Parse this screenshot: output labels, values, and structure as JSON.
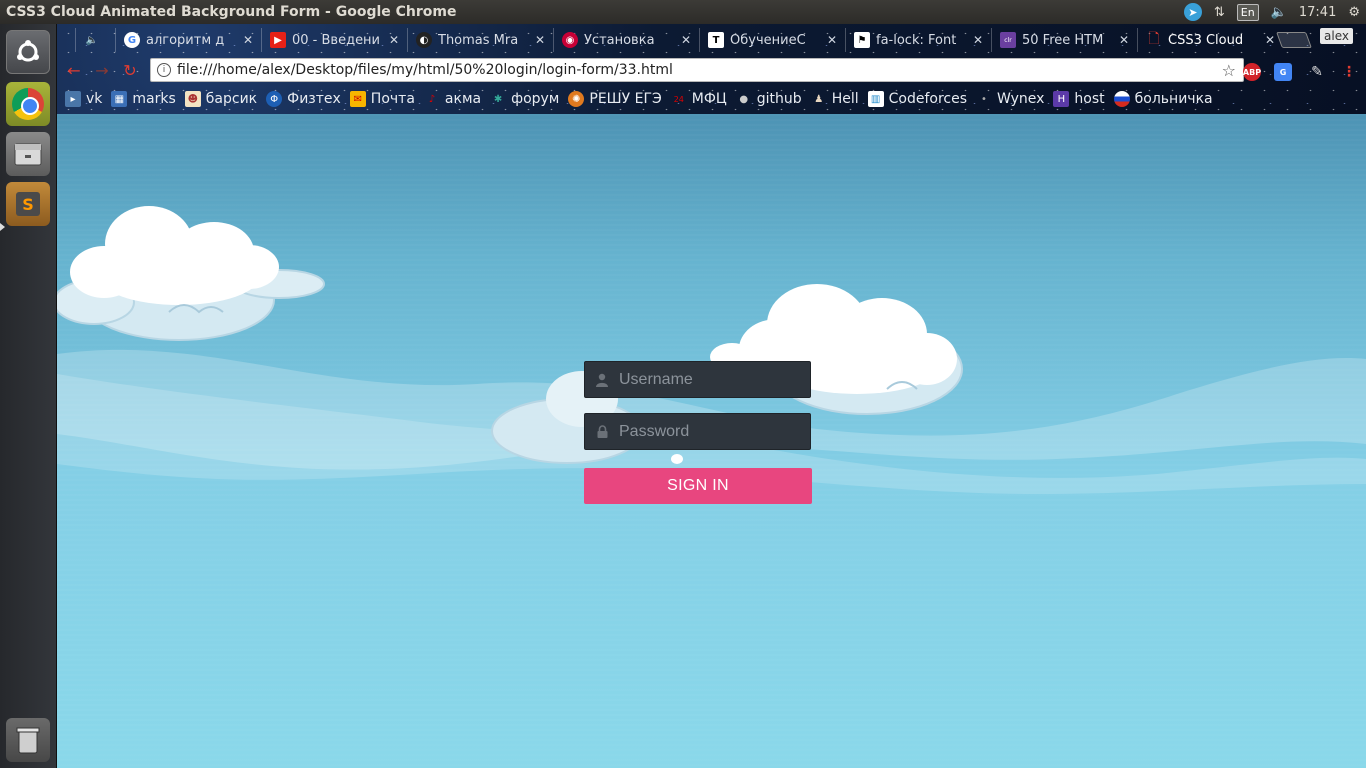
{
  "top_panel": {
    "window_title": "CSS3 Cloud Animated Background Form - Google Chrome",
    "keyboard_layout": "En",
    "clock": "17:41",
    "icons": [
      "telegram-icon",
      "network-icon",
      "volume-icon",
      "settings-gear-icon"
    ]
  },
  "launcher": {
    "items": [
      "dash-icon",
      "chrome-icon",
      "files-icon",
      "sublime-text-icon",
      "trash-icon"
    ]
  },
  "browser": {
    "profile_name": "alex",
    "tabs": [
      {
        "title": "алгоритм д",
        "icon": "google-icon",
        "active": false
      },
      {
        "title": "00 - Введени",
        "icon": "youtube-icon",
        "active": false
      },
      {
        "title": "Thomas Mra",
        "icon": "github-octocat-icon",
        "active": false
      },
      {
        "title": "Установка",
        "icon": "debian-icon",
        "active": false
      },
      {
        "title": "ОбучениеС",
        "icon": "t-letter-icon",
        "active": false
      },
      {
        "title": "fa-lock: Font",
        "icon": "flag-icon",
        "active": false
      },
      {
        "title": "50 Free HTM",
        "icon": "colorlib-icon",
        "active": false
      },
      {
        "title": "CSS3 Cloud",
        "icon": "document-icon",
        "active": true
      }
    ],
    "url": "file:///home/alex/Desktop/files/my/html/50%20login/login-form/33.html",
    "bookmarks": [
      {
        "label": "vk",
        "icon": "vk-icon"
      },
      {
        "label": "marks",
        "icon": "grid-icon"
      },
      {
        "label": "барсик",
        "icon": "cat-icon"
      },
      {
        "label": "Физтех",
        "icon": "phystech-icon"
      },
      {
        "label": "Почта",
        "icon": "mail-icon"
      },
      {
        "label": "акма",
        "icon": "akma-icon"
      },
      {
        "label": "форум",
        "icon": "forum-icon"
      },
      {
        "label": "РЕШУ ЕГЭ",
        "icon": "reshu-ege-icon"
      },
      {
        "label": "МФЦ",
        "icon": "mfc-icon"
      },
      {
        "label": "github",
        "icon": "github-icon"
      },
      {
        "label": "Hell",
        "icon": "person-icon"
      },
      {
        "label": "Codeforces",
        "icon": "codeforces-icon"
      },
      {
        "label": "Wynex",
        "icon": "wynex-icon"
      },
      {
        "label": "host",
        "icon": "host-icon"
      },
      {
        "label": "больничка",
        "icon": "russia-flag-icon"
      }
    ],
    "extensions": [
      "adblock-plus-icon",
      "google-translate-icon",
      "eyedropper-icon",
      "more-menu-icon"
    ]
  },
  "login": {
    "username_placeholder": "Username",
    "password_placeholder": "Password",
    "signin_label": "SIGN IN",
    "accent_color": "#e8467f",
    "field_color": "#2e353d"
  }
}
